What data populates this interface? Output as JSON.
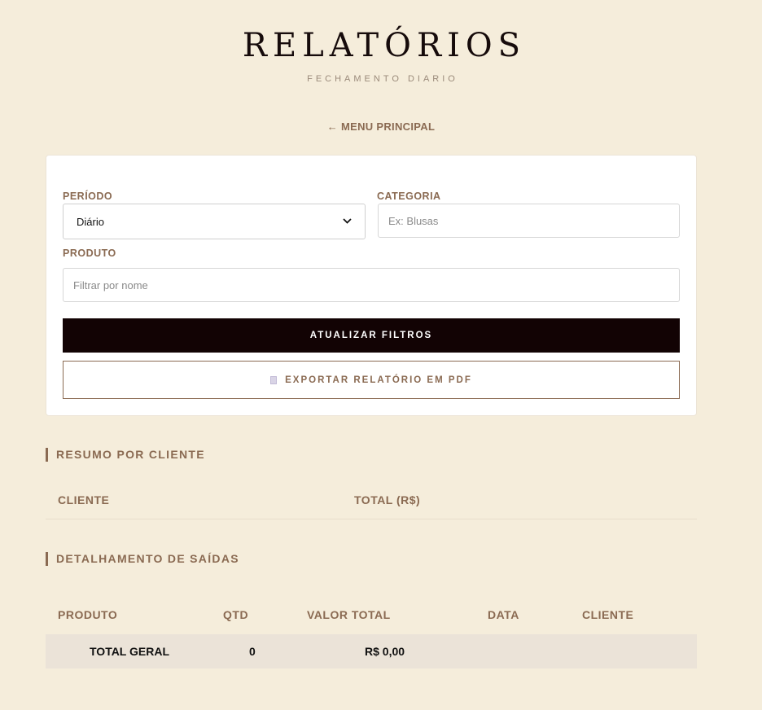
{
  "header": {
    "title": "RELATÓRIOS",
    "subtitle": "FECHAMENTO DIARIO"
  },
  "nav": {
    "back_label": "← MENU PRINCIPAL"
  },
  "filters": {
    "period_label": "PERÍODO",
    "period_value": "Diário",
    "category_label": "CATEGORIA",
    "category_placeholder": "Ex: Blusas",
    "product_label": "PRODUTO",
    "product_placeholder": "Filtrar por nome",
    "update_button": "ATUALIZAR FILTROS",
    "export_button": "EXPORTAR RELATÓRIO EM PDF"
  },
  "client_summary": {
    "title": "RESUMO POR CLIENTE",
    "columns": [
      "CLIENTE",
      "TOTAL (R$)"
    ]
  },
  "outputs_detail": {
    "title": "DETALHAMENTO DE SAÍDAS",
    "columns": [
      "PRODUTO",
      "QTD",
      "VALOR TOTAL",
      "DATA",
      "CLIENTE"
    ],
    "total_row": {
      "label": "TOTAL GERAL",
      "qty": "0",
      "value": "R$ 0,00"
    }
  },
  "colors": {
    "background": "#f5eddb",
    "accent": "#8a6a52",
    "primary_button": "#120304"
  }
}
